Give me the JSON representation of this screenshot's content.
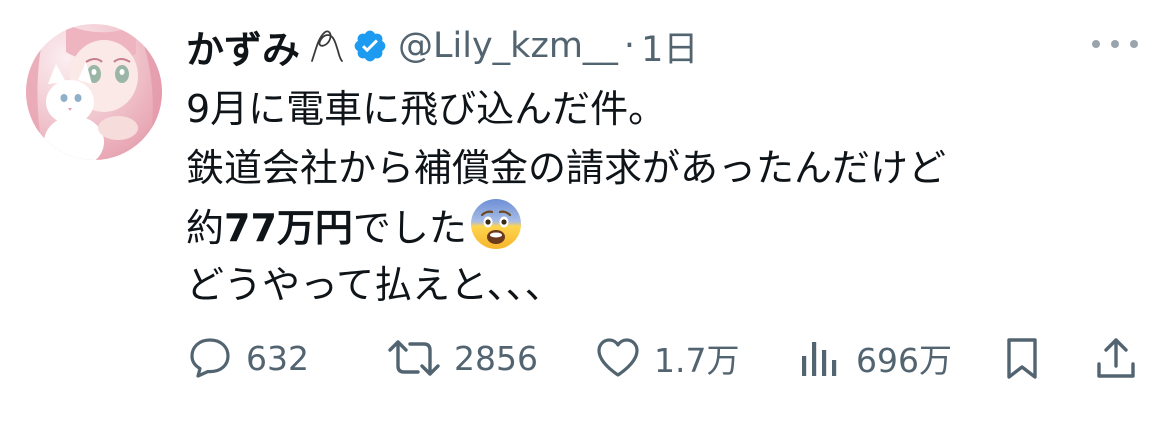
{
  "tweet": {
    "author": {
      "display_name": "かずみ",
      "handle": "@Lily_kzm__",
      "verified": true,
      "avatar_icon": "avatar-anime-girl-with-white-cat"
    },
    "separator": "·",
    "time": "1日",
    "text": {
      "line1": "9月に電車に飛び込んだ件。",
      "line2": "鉄道会社から補償金の請求があったんだけど",
      "line3_prefix": "約",
      "line3_bold": "77万円",
      "line3_suffix": "でした",
      "line3_emoji": "fearful-face-emoji",
      "line4": "どうやって払えと、、、"
    },
    "metrics": {
      "replies": "632",
      "reposts": "2856",
      "likes": "1.7万",
      "views": "696万"
    },
    "icons": {
      "reply": "speech-bubble-icon",
      "repost": "repost-arrows-icon",
      "like": "heart-icon",
      "views": "bar-chart-icon",
      "bookmark": "bookmark-icon",
      "share": "share-upload-icon",
      "more": "more-dots-icon"
    },
    "colors": {
      "text": "#0f1419",
      "secondary": "#536471",
      "verified_badge": "#1d9bf0"
    }
  }
}
